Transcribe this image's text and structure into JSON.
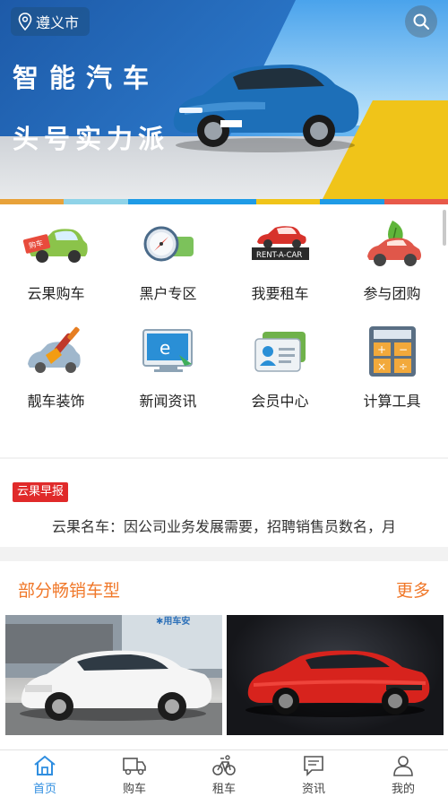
{
  "banner": {
    "city": "遵义市",
    "headline_line1": "智能汽车",
    "headline_line2": "头号实力派",
    "stripe_colors": [
      "#e8a23a",
      "#8fd3e8",
      "#1f9be6",
      "#f0c419",
      "#e8594a"
    ]
  },
  "search": {
    "icon": "search-icon"
  },
  "menu": {
    "row1": [
      {
        "label": "云果购车",
        "icon": "buy-car-icon"
      },
      {
        "label": "黑户专区",
        "icon": "compass-icon"
      },
      {
        "label": "我要租车",
        "icon": "rent-a-car-icon"
      },
      {
        "label": "参与团购",
        "icon": "group-buy-icon"
      }
    ],
    "row2": [
      {
        "label": "靓车装饰",
        "icon": "paint-brush-icon"
      },
      {
        "label": "新闻资讯",
        "icon": "news-icon"
      },
      {
        "label": "会员中心",
        "icon": "member-card-icon"
      },
      {
        "label": "计算工具",
        "icon": "calculator-icon"
      }
    ],
    "rent_sign_text": "RENT-A-CAR"
  },
  "news": {
    "tag": "云果早报",
    "text": "云果名车：因公司业务发展需要，招聘销售员数名，月"
  },
  "hot": {
    "title": "部分畅销车型",
    "more": "更多",
    "cards": [
      {
        "color": "white",
        "backdrop_text": "用车安"
      },
      {
        "color": "red"
      }
    ]
  },
  "tabbar": {
    "tabs": [
      {
        "label": "首页",
        "icon": "home-icon",
        "active": true
      },
      {
        "label": "购车",
        "icon": "truck-icon",
        "active": false
      },
      {
        "label": "租车",
        "icon": "bicycle-icon",
        "active": false
      },
      {
        "label": "资讯",
        "icon": "message-icon",
        "active": false
      },
      {
        "label": "我的",
        "icon": "user-icon",
        "active": false
      }
    ],
    "active_color": "#2f8ee0"
  },
  "colors": {
    "accent_orange": "#f0782a",
    "tag_red": "#e02a2a"
  }
}
